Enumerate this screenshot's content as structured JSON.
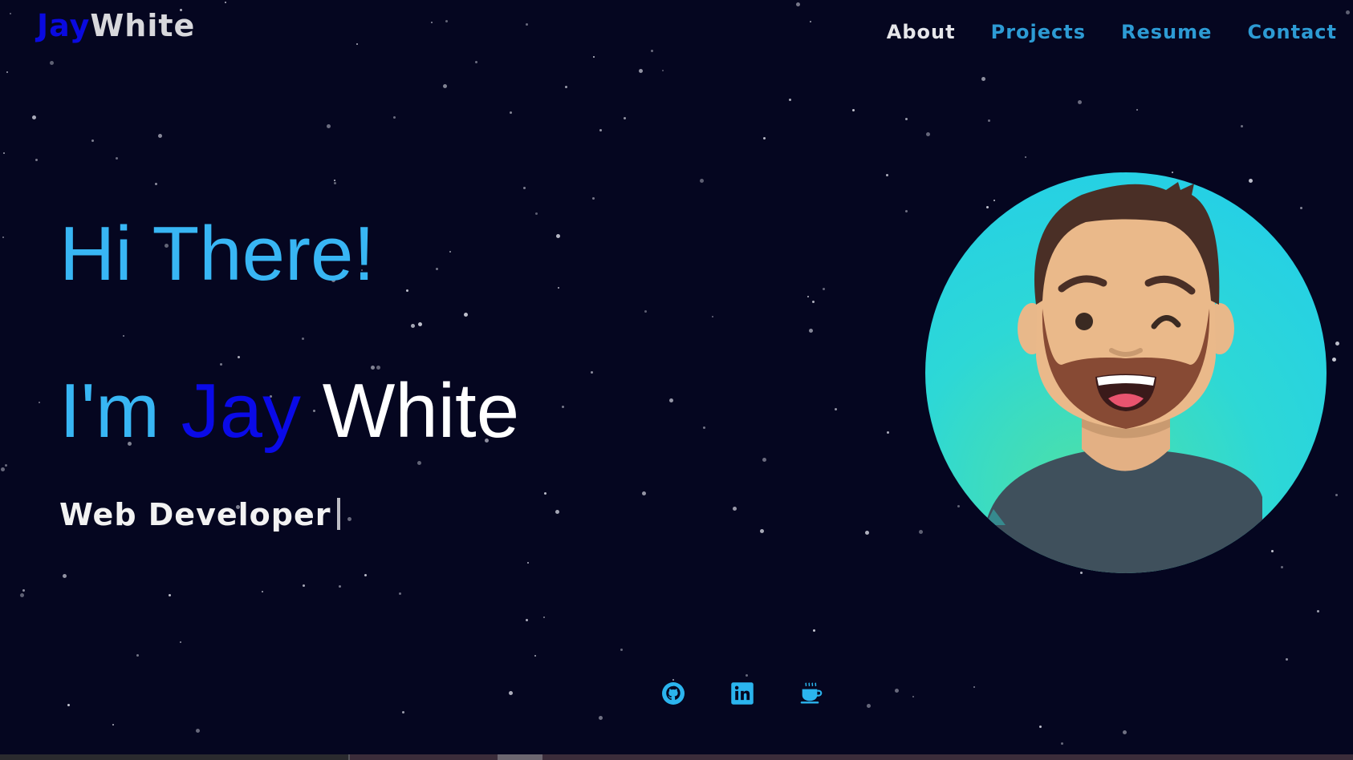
{
  "header": {
    "logo_first": "Jay",
    "logo_last": "White",
    "nav": [
      {
        "label": "About",
        "active": true
      },
      {
        "label": "Projects",
        "active": false
      },
      {
        "label": "Resume",
        "active": false
      },
      {
        "label": "Contact",
        "active": false
      }
    ]
  },
  "hero": {
    "greeting": "Hi There!",
    "intro_prefix": "I'm",
    "intro_first": "Jay",
    "intro_last": "White",
    "role": "Web Developer"
  },
  "avatar": {
    "icon": "memoji-avatar"
  },
  "social": [
    {
      "icon": "github-icon"
    },
    {
      "icon": "linkedin-icon"
    },
    {
      "icon": "coffee-icon"
    }
  ],
  "colors": {
    "background": "#050620",
    "accent_light_blue": "#38b6f4",
    "accent_deep_blue": "#0a0ae8",
    "nav_blue": "#2d9bd4",
    "text_white": "#ffffff"
  }
}
